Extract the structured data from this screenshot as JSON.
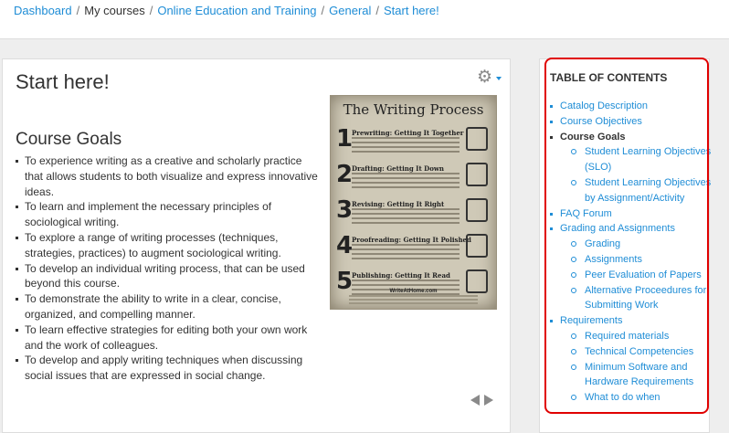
{
  "breadcrumb": {
    "items": [
      {
        "label": "Dashboard",
        "link": true
      },
      {
        "label": "My courses",
        "link": false
      },
      {
        "label": "Online Education and Training",
        "link": true
      },
      {
        "label": "General",
        "link": true
      },
      {
        "label": "Start here!",
        "link": true
      }
    ],
    "separator": "/"
  },
  "main": {
    "title": "Start here!",
    "heading": "Course Goals",
    "goals": [
      "To experience writing as a creative and scholarly practice that allows students to both visualize and express innovative ideas.",
      "To learn and implement the necessary principles of sociological writing.",
      "To explore a range of writing processes (techniques, strategies, practices) to augment sociological writing.",
      "To develop an individual writing process, that can be used beyond this course.",
      "To demonstrate the ability to write in a clear, concise, organized, and compelling manner.",
      "To learn effective strategies for editing both your own work and the work of colleagues.",
      "To develop and apply writing techniques when discussing social issues that are expressed in social change."
    ],
    "icons": {
      "settings": "gear-icon",
      "prev": "arrow-left-icon",
      "next": "arrow-right-icon"
    }
  },
  "poster": {
    "title": "The Writing Process",
    "steps": [
      {
        "num": "1",
        "name": "Prewriting: Getting It Together",
        "icon": "lightbulb-icon"
      },
      {
        "num": "2",
        "name": "Drafting: Getting It Down",
        "icon": "notepad-icon"
      },
      {
        "num": "3",
        "name": "Revising: Getting It Right",
        "icon": "edit-icon"
      },
      {
        "num": "4",
        "name": "Proofreading: Getting It Polished",
        "icon": "magnifier-icon"
      },
      {
        "num": "5",
        "name": "Publishing: Getting It Read",
        "icon": "reader-icon"
      }
    ],
    "footer": "WriteAtHome.com"
  },
  "toc": {
    "title": "TABLE OF CONTENTS",
    "items": [
      {
        "label": "Catalog Description",
        "current": false,
        "children": []
      },
      {
        "label": "Course Objectives",
        "current": false,
        "children": []
      },
      {
        "label": "Course Goals",
        "current": true,
        "children": [
          {
            "label": "Student Learning Objectives (SLO)"
          },
          {
            "label": "Student Learning Objectives by Assignment/Activity"
          }
        ]
      },
      {
        "label": "FAQ Forum",
        "current": false,
        "children": []
      },
      {
        "label": "Grading and Assignments",
        "current": false,
        "children": [
          {
            "label": "Grading"
          },
          {
            "label": "Assignments"
          },
          {
            "label": "Peer Evaluation of Papers"
          },
          {
            "label": "Alternative Proceedures for Submitting Work"
          }
        ]
      },
      {
        "label": "Requirements",
        "current": false,
        "children": [
          {
            "label": "Required materials"
          },
          {
            "label": "Technical Competencies"
          },
          {
            "label": "Minimum Software and Hardware Requirements"
          },
          {
            "label": "What to do when"
          }
        ]
      }
    ]
  },
  "colors": {
    "link": "#1f8dd6",
    "highlight": "#e00000",
    "text": "#333333"
  }
}
